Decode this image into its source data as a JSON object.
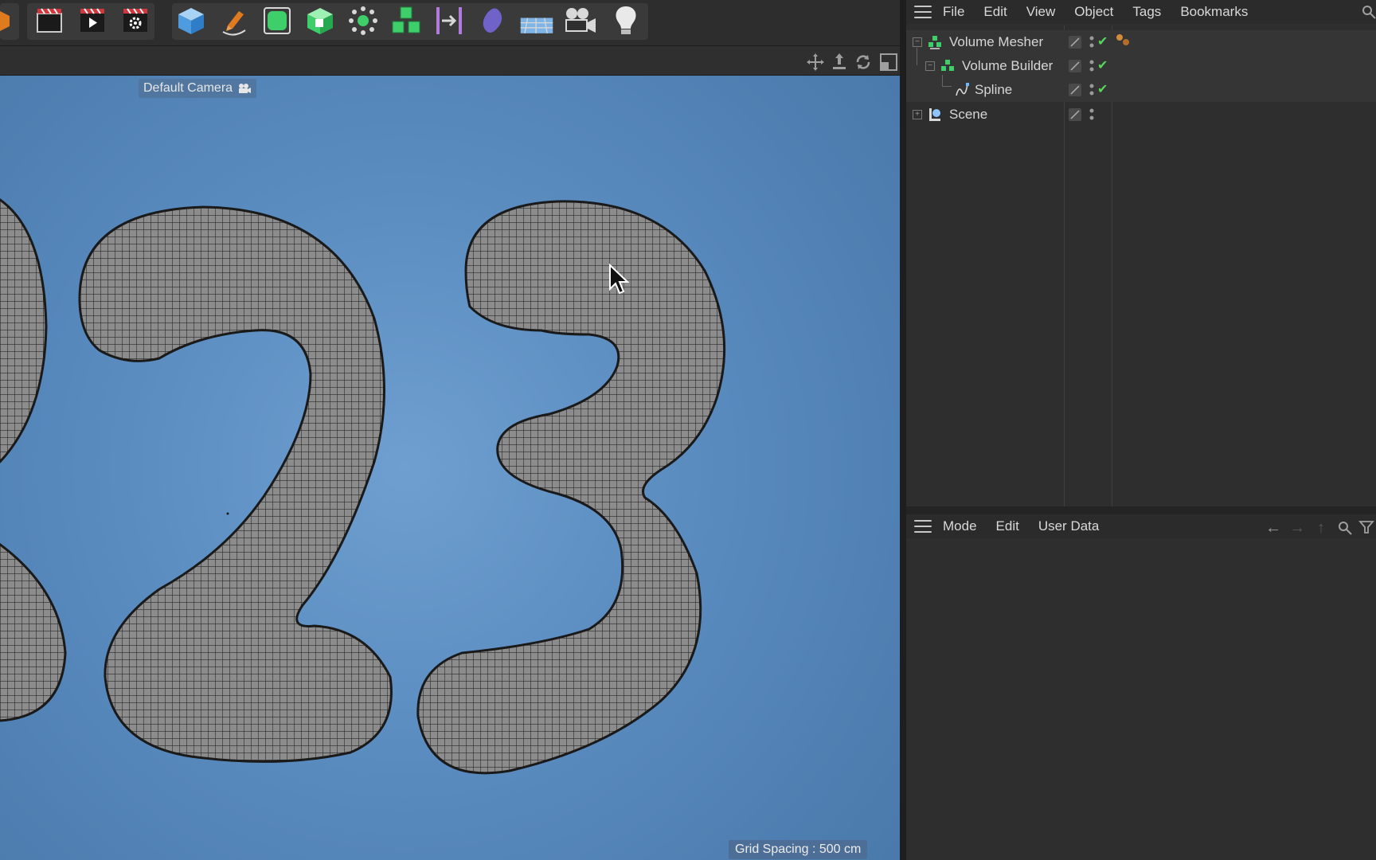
{
  "viewport": {
    "camera_label": "Default Camera",
    "grid_spacing": "Grid Spacing : 500 cm"
  },
  "object_manager": {
    "menu": [
      "File",
      "Edit",
      "View",
      "Object",
      "Tags",
      "Bookmarks"
    ],
    "tree": [
      {
        "label": "Volume Mesher",
        "icon": "volume-mesher-icon",
        "expanded": true,
        "checked": true
      },
      {
        "label": "Volume Builder",
        "icon": "volume-builder-icon",
        "expanded": true,
        "checked": true
      },
      {
        "label": "Spline",
        "icon": "spline-icon",
        "checked": true
      },
      {
        "label": "Scene",
        "icon": "scene-icon",
        "expanded": false,
        "checked": false
      }
    ]
  },
  "attribute_manager": {
    "menu": [
      "Mode",
      "Edit",
      "User Data"
    ]
  },
  "colors": {
    "viewport_bg": "#5a8cc0",
    "panel_bg": "#2e2e2e",
    "check_green": "#56d65c",
    "object_green": "#3fcf6a"
  }
}
